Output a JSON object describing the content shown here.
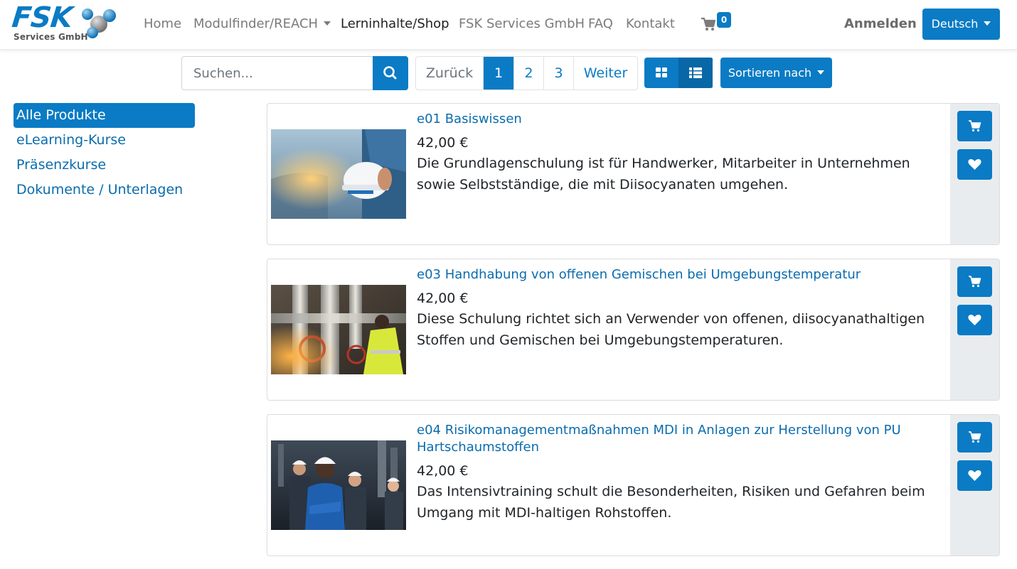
{
  "brand": {
    "logo_text": "FSK",
    "logo_subtext": "Services GmbH",
    "accent": "#0a7bc4"
  },
  "nav": {
    "items": [
      {
        "label": "Home"
      },
      {
        "label": "Modulfinder/REACH"
      },
      {
        "label": "Lerninhalte/Shop"
      },
      {
        "label": "FSK Services GmbH"
      },
      {
        "label": "FAQ"
      },
      {
        "label": "Kontakt"
      }
    ],
    "cart_count": "0",
    "login_label": "Anmelden",
    "language_label": "Deutsch"
  },
  "toolbar": {
    "search_placeholder": "Suchen...",
    "pager": {
      "prev": "Zurück",
      "pages": [
        "1",
        "2",
        "3"
      ],
      "current": "1",
      "next": "Weiter"
    },
    "sort_label": "Sortieren nach"
  },
  "sidebar": {
    "categories": [
      {
        "label": "Alle Produkte",
        "active": true
      },
      {
        "label": "eLearning-Kurse",
        "active": false
      },
      {
        "label": "Präsenzkurse",
        "active": false
      },
      {
        "label": "Dokumente / Unterlagen",
        "active": false
      }
    ]
  },
  "products": [
    {
      "title": "e01 Basiswissen",
      "price": "42,00 €",
      "description": "Die Grundlagenschulung ist für Handwerker, Mitarbeiter in Unternehmen sowie Selbstständige, die mit Diisocyanaten umgehen."
    },
    {
      "title": "e03 Handhabung von offenen Gemischen bei Umgebungstemperatur",
      "price": "42,00 €",
      "description": "Diese Schulung richtet sich an Verwender von offenen, diisocyanathaltigen Stoffen und Gemischen bei Umgebungstemperaturen."
    },
    {
      "title": "e04 Risikomanagementmaßnahmen MDI in Anlagen zur Herstellung von PU Hartschaumstoffen",
      "price": "42,00 €",
      "description": "Das Intensivtraining schult die Besonderheiten, Risiken und Gefahren beim Umgang mit MDI-haltigen Rohstoffen."
    }
  ]
}
